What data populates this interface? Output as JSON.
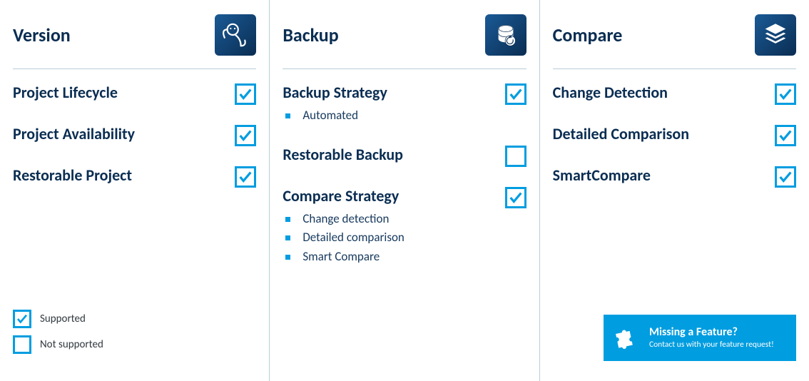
{
  "columns": [
    {
      "title": "Version",
      "icon": "robot-icon",
      "features": [
        {
          "name": "Project Lifecycle",
          "supported": true,
          "sub": []
        },
        {
          "name": "Project Availability",
          "supported": true,
          "sub": []
        },
        {
          "name": "Restorable Project",
          "supported": true,
          "sub": []
        }
      ]
    },
    {
      "title": "Backup",
      "icon": "database-icon",
      "features": [
        {
          "name": "Backup Strategy",
          "supported": true,
          "sub": [
            "Automated"
          ]
        },
        {
          "name": "Restorable Backup",
          "supported": false,
          "sub": []
        },
        {
          "name": "Compare Strategy",
          "supported": true,
          "sub": [
            "Change detection",
            "Detailed comparison",
            "Smart Compare"
          ]
        }
      ]
    },
    {
      "title": "Compare",
      "icon": "layers-icon",
      "features": [
        {
          "name": "Change Detection",
          "supported": true,
          "sub": []
        },
        {
          "name": "Detailed Comparison",
          "supported": true,
          "sub": []
        },
        {
          "name": "SmartCompare",
          "supported": true,
          "sub": []
        }
      ]
    }
  ],
  "legend": {
    "supported": "Supported",
    "not_supported": "Not supported"
  },
  "cta": {
    "title": "Missing a Feature?",
    "sub": "Contact us with your feature request!"
  }
}
